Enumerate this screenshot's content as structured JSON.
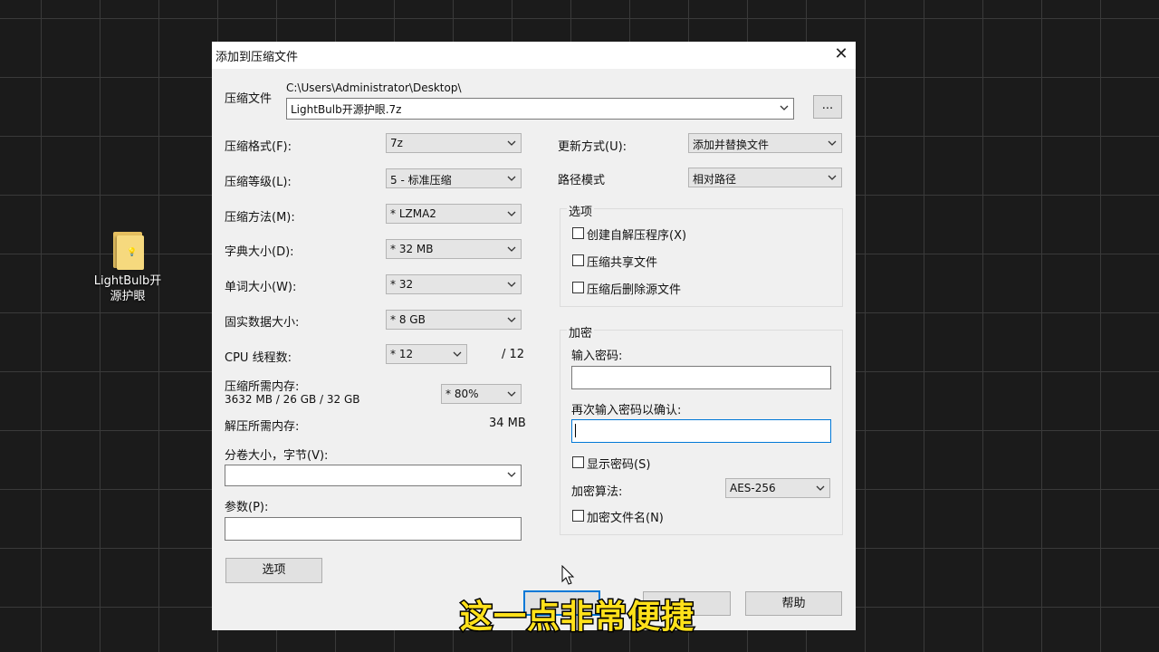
{
  "desktop": {
    "icon_label_line1": "LightBulb开",
    "icon_label_line2": "源护眼"
  },
  "dialog": {
    "title": "添加到压缩文件",
    "archive": {
      "label": "压缩文件",
      "path": "C:\\Users\\Administrator\\Desktop\\",
      "filename": "LightBulb开源护眼.7z",
      "browse_label": "..."
    },
    "left": {
      "format": {
        "label": "压缩格式(F):",
        "value": "7z"
      },
      "level": {
        "label": "压缩等级(L):",
        "value": "5 - 标准压缩"
      },
      "method": {
        "label": "压缩方法(M):",
        "value": "* LZMA2"
      },
      "dictionary": {
        "label": "字典大小(D):",
        "value": "* 32 MB"
      },
      "word": {
        "label": "单词大小(W):",
        "value": "* 32"
      },
      "solid": {
        "label": "固实数据大小:",
        "value": "* 8 GB"
      },
      "cpu": {
        "label": "CPU 线程数:",
        "value": "* 12",
        "max": "/ 12"
      },
      "memory": {
        "label": "压缩所需内存:",
        "detail": "3632 MB / 26 GB / 32 GB",
        "value": "* 80%"
      },
      "decompress": {
        "label": "解压所需内存:",
        "value": "34 MB"
      },
      "volume": {
        "label": "分卷大小，字节(V):",
        "value": ""
      },
      "params": {
        "label": "参数(P):",
        "value": ""
      },
      "options_button": "选项"
    },
    "right": {
      "update": {
        "label": "更新方式(U):",
        "value": "添加并替换文件"
      },
      "path_mode": {
        "label": "路径模式",
        "value": "相对路径"
      },
      "options": {
        "title": "选项",
        "sfx": "创建自解压程序(X)",
        "shared": "压缩共享文件",
        "delete": "压缩后删除源文件"
      },
      "encryption": {
        "title": "加密",
        "password_label": "输入密码:",
        "confirm_label": "再次输入密码以确认:",
        "show_password": "显示密码(S)",
        "method_label": "加密算法:",
        "method_value": "AES-256",
        "encrypt_names": "加密文件名(N)"
      }
    },
    "buttons": {
      "help": "帮助"
    }
  },
  "subtitle": "这一点非常便捷"
}
